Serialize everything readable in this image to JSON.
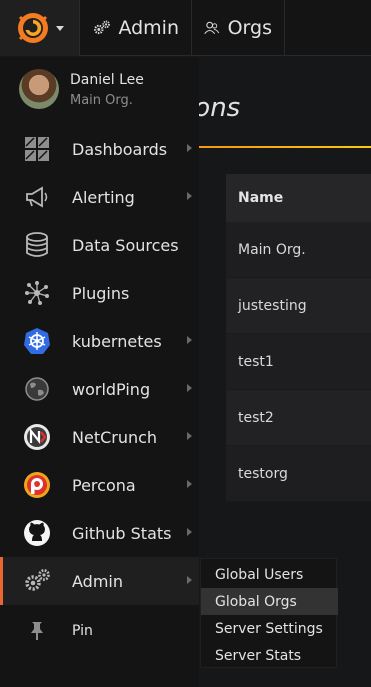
{
  "topbar": {
    "admin_label": "Admin",
    "orgs_label": "Orgs"
  },
  "page": {
    "title": "Organizations",
    "table_header": "Name",
    "rows": [
      "Main Org.",
      "justesting",
      "test1",
      "test2",
      "testorg"
    ]
  },
  "profile": {
    "name": "Daniel Lee",
    "org": "Main Org."
  },
  "menu": {
    "items": [
      {
        "label": "Dashboards",
        "icon": "dashboards-grid-icon",
        "arrow": true
      },
      {
        "label": "Alerting",
        "icon": "megaphone-icon",
        "arrow": true
      },
      {
        "label": "Data Sources",
        "icon": "database-icon",
        "arrow": false
      },
      {
        "label": "Plugins",
        "icon": "plugins-network-icon",
        "arrow": false
      },
      {
        "label": "kubernetes",
        "icon": "kubernetes-wheel-icon",
        "arrow": true
      },
      {
        "label": "worldPing",
        "icon": "globe-icon",
        "arrow": true
      },
      {
        "label": "NetCrunch",
        "icon": "netcrunch-logo-icon",
        "arrow": true
      },
      {
        "label": "Percona",
        "icon": "percona-logo-icon",
        "arrow": true
      },
      {
        "label": "Github Stats",
        "icon": "github-octocat-icon",
        "arrow": true
      },
      {
        "label": "Admin",
        "icon": "admin-gears-icon",
        "arrow": true,
        "active": true
      },
      {
        "label": "Pin",
        "icon": "pin-icon",
        "arrow": false
      }
    ]
  },
  "submenu": {
    "items": [
      "Global Users",
      "Global Orgs",
      "Server Settings",
      "Server Stats"
    ],
    "active": "Global Orgs"
  },
  "colors": {
    "accent": "#e8662f",
    "background": "#161719",
    "menu_bg": "#141414"
  }
}
